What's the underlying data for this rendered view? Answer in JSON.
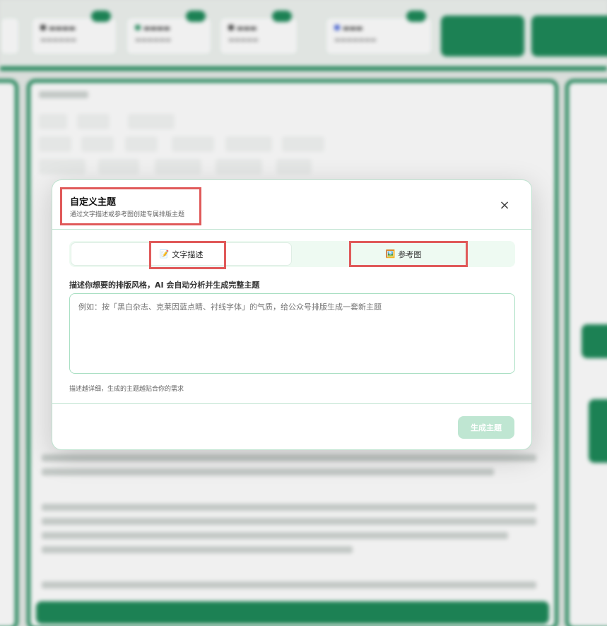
{
  "modal": {
    "title": "自定义主题",
    "subtitle": "通过文字描述或参考图创建专属排版主题",
    "close_icon": "×",
    "tabs": [
      {
        "label": "文字描述",
        "icon": "memo-icon",
        "icon_glyph": "📝",
        "active": true
      },
      {
        "label": "参考图",
        "icon": "picture-icon",
        "icon_glyph": "🖼️",
        "active": false
      }
    ],
    "description_label": "描述你想要的排版风格，AI 会自动分析并生成完整主题",
    "description_placeholder": "例如：按「黑白杂志、克莱因蓝点睛、衬线字体」的气质，给公众号排版生成一套新主题",
    "hint": "描述越详细，生成的主题越贴合你的需求",
    "generate_button": "生成主题"
  },
  "colors": {
    "accent": "#1e8a5a",
    "highlight_box": "#e05a5a",
    "disabled_button": "#bfe6d2"
  }
}
